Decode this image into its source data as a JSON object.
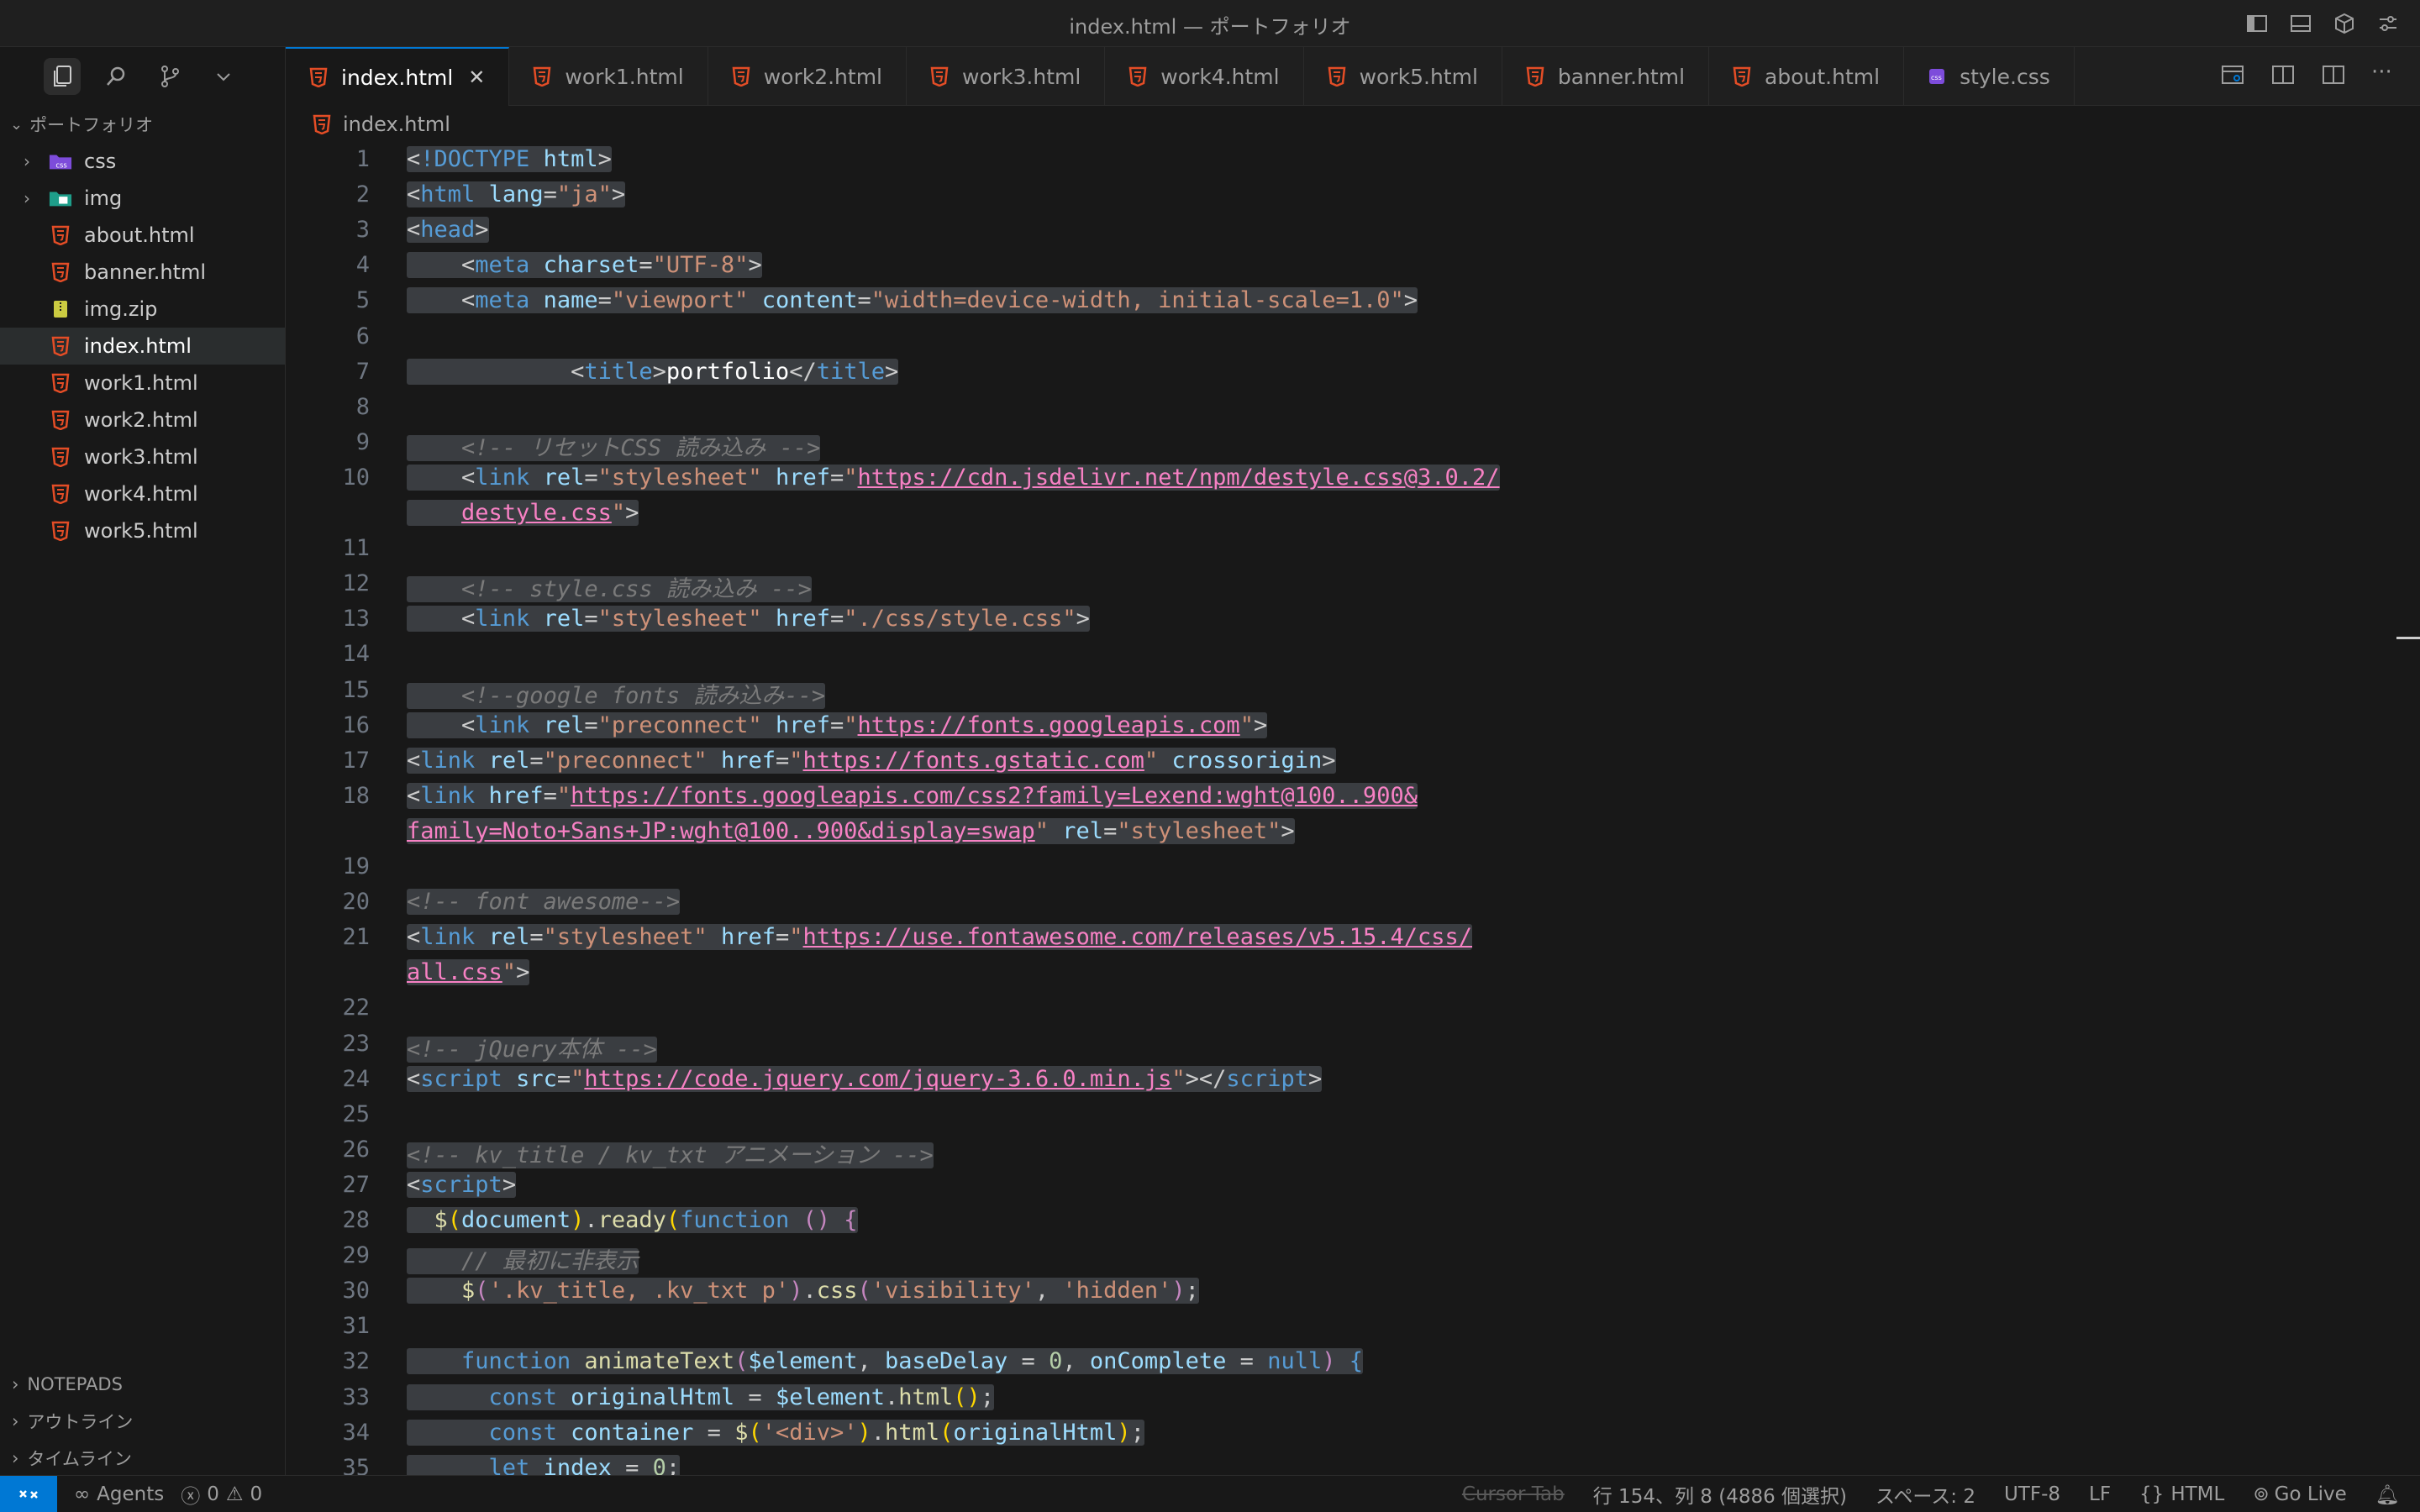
{
  "window": {
    "title": "index.html — ポートフォリオ"
  },
  "sidebar": {
    "project": "ポートフォリオ",
    "tree": [
      {
        "type": "folder",
        "label": "css",
        "icon": "css-folder-icon"
      },
      {
        "type": "folder",
        "label": "img",
        "icon": "image-folder-icon"
      },
      {
        "type": "file",
        "label": "about.html",
        "icon": "html-file-icon"
      },
      {
        "type": "file",
        "label": "banner.html",
        "icon": "html-file-icon"
      },
      {
        "type": "file",
        "label": "img.zip",
        "icon": "zip-file-icon"
      },
      {
        "type": "file",
        "label": "index.html",
        "icon": "html-file-icon",
        "selected": true
      },
      {
        "type": "file",
        "label": "work1.html",
        "icon": "html-file-icon"
      },
      {
        "type": "file",
        "label": "work2.html",
        "icon": "html-file-icon"
      },
      {
        "type": "file",
        "label": "work3.html",
        "icon": "html-file-icon"
      },
      {
        "type": "file",
        "label": "work4.html",
        "icon": "html-file-icon"
      },
      {
        "type": "file",
        "label": "work5.html",
        "icon": "html-file-icon"
      }
    ],
    "sections": [
      "NOTEPADS",
      "アウトライン",
      "タイムライン"
    ]
  },
  "tabs": [
    {
      "label": "index.html",
      "active": true
    },
    {
      "label": "work1.html"
    },
    {
      "label": "work2.html"
    },
    {
      "label": "work3.html"
    },
    {
      "label": "work4.html"
    },
    {
      "label": "work5.html"
    },
    {
      "label": "banner.html"
    },
    {
      "label": "about.html"
    },
    {
      "label": "style.css",
      "css": true
    }
  ],
  "breadcrumb": "index.html",
  "code": [
    {
      "n": "1",
      "h": "<span class='hl'>&lt;<span class='t'>!DOCTYPE</span> <span class='a'>html</span>&gt;</span>"
    },
    {
      "n": "2",
      "h": "<span class='hl'>&lt;<span class='t'>html</span> <span class='a'>lang</span>=<span class='s'>\"ja\"</span>&gt;</span>"
    },
    {
      "n": "3",
      "h": "<span class='hl'>&lt;<span class='t'>head</span>&gt;</span>"
    },
    {
      "n": "4",
      "h": "<span class='hl'>    &lt;<span class='t'>meta</span> <span class='a'>charset</span>=<span class='s'>\"UTF-8\"</span>&gt;</span>"
    },
    {
      "n": "5",
      "h": "<span class='hl'>    &lt;<span class='t'>meta</span> <span class='a'>name</span>=<span class='s'>\"viewport\"</span> <span class='a'>content</span>=<span class='s'>\"width=device-width, initial-scale=1.0\"</span>&gt;</span>"
    },
    {
      "n": "6",
      "h": ""
    },
    {
      "n": "7",
      "h": "<span class='hl'>            &lt;<span class='t'>title</span>&gt;<span class='w'>portfolio</span>&lt;/<span class='t'>title</span>&gt;</span>"
    },
    {
      "n": "8",
      "h": ""
    },
    {
      "n": "9",
      "h": "<span class='hl'>    <span class='c'>&lt;!-- リセットCSS 読み込み --&gt;</span></span>"
    },
    {
      "n": "10",
      "h": "<span class='hl'>    &lt;<span class='t'>link</span> <span class='a'>rel</span>=<span class='s'>\"stylesheet\"</span> <span class='a'>href</span>=<span class='s'>\"</span><span class='u'>https://cdn.jsdelivr.net/npm/destyle.css@3.0.2/</span></span>"
    },
    {
      "n": "",
      "h": "<span class='hl'>    <span class='u'>destyle.css</span><span class='s'>\"</span>&gt;</span>"
    },
    {
      "n": "11",
      "h": ""
    },
    {
      "n": "12",
      "h": "<span class='hl'>    <span class='c'>&lt;!-- style.css 読み込み --&gt;</span></span>"
    },
    {
      "n": "13",
      "h": "<span class='hl'>    &lt;<span class='t'>link</span> <span class='a'>rel</span>=<span class='s'>\"stylesheet\"</span> <span class='a'>href</span>=<span class='s'>\"./css/style.css\"</span>&gt;</span>"
    },
    {
      "n": "14",
      "h": ""
    },
    {
      "n": "15",
      "h": "<span class='hl'>    <span class='c'>&lt;!--google fonts 読み込み--&gt;</span></span>"
    },
    {
      "n": "16",
      "h": "<span class='hl'>    &lt;<span class='t'>link</span> <span class='a'>rel</span>=<span class='s'>\"preconnect\"</span> <span class='a'>href</span>=<span class='s'>\"</span><span class='u'>https://fonts.googleapis.com</span><span class='s'>\"</span>&gt;</span>"
    },
    {
      "n": "17",
      "h": "<span class='hl'>&lt;<span class='t'>link</span> <span class='a'>rel</span>=<span class='s'>\"preconnect\"</span> <span class='a'>href</span>=<span class='s'>\"</span><span class='u'>https://fonts.gstatic.com</span><span class='s'>\"</span> <span class='a'>crossorigin</span>&gt;</span>"
    },
    {
      "n": "18",
      "h": "<span class='hl'>&lt;<span class='t'>link</span> <span class='a'>href</span>=<span class='s'>\"</span><span class='u'>https://fonts.googleapis.com/css2?family=Lexend:wght@100..900&amp;</span></span>"
    },
    {
      "n": "",
      "h": "<span class='hl'><span class='u'>family=Noto+Sans+JP:wght@100..900&amp;display=swap</span><span class='s'>\"</span> <span class='a'>rel</span>=<span class='s'>\"stylesheet\"</span>&gt;</span>"
    },
    {
      "n": "19",
      "h": ""
    },
    {
      "n": "20",
      "h": "<span class='hl'><span class='c'>&lt;!-- font awesome--&gt;</span></span>"
    },
    {
      "n": "21",
      "h": "<span class='hl'>&lt;<span class='t'>link</span> <span class='a'>rel</span>=<span class='s'>\"stylesheet\"</span> <span class='a'>href</span>=<span class='s'>\"</span><span class='u'>https://use.fontawesome.com/releases/v5.15.4/css/</span></span>"
    },
    {
      "n": "",
      "h": "<span class='hl'><span class='u'>all.css</span><span class='s'>\"</span>&gt;</span>"
    },
    {
      "n": "22",
      "h": ""
    },
    {
      "n": "23",
      "h": "<span class='hl'><span class='c'>&lt;!-- jQuery本体 --&gt;</span></span>"
    },
    {
      "n": "24",
      "h": "<span class='hl'>&lt;<span class='t'>script</span> <span class='a'>src</span>=<span class='s'>\"</span><span class='u'>https://code.jquery.com/jquery-3.6.0.min.js</span><span class='s'>\"</span>&gt;&lt;/<span class='t'>script</span>&gt;</span>"
    },
    {
      "n": "25",
      "h": ""
    },
    {
      "n": "26",
      "h": "<span class='hl'><span class='c'>&lt;!-- kv_title / kv_txt アニメーション --&gt;</span></span>"
    },
    {
      "n": "27",
      "h": "<span class='hl'>&lt;<span class='t'>script</span>&gt;</span>"
    },
    {
      "n": "28",
      "h": "<span class='hl'>  <span class='f'>$</span><span class='p'>(</span><span class='a'>document</span><span class='p'>)</span>.<span class='f'>ready</span><span class='p'>(</span><span class='t'>function</span> <span class='k'>()</span> <span class='k'>{</span></span>"
    },
    {
      "n": "29",
      "h": "<span class='hl'>    <span class='c'>// 最初に非表示</span></span>"
    },
    {
      "n": "30",
      "h": "<span class='hl'>    <span class='f'>$</span><span class='k'>(</span><span class='s'>'.kv_title, .kv_txt p'</span><span class='k'>)</span>.<span class='f'>css</span><span class='k'>(</span><span class='s'>'visibility'</span>, <span class='s'>'hidden'</span><span class='k'>)</span>;</span>"
    },
    {
      "n": "31",
      "h": ""
    },
    {
      "n": "32",
      "h": "<span class='hl'>    <span class='t'>function</span> <span class='f'>animateText</span><span class='k'>(</span><span class='a'>$element</span>, <span class='a'>baseDelay</span> = <span class='n'>0</span>, <span class='a'>onComplete</span> = <span class='t'>null</span><span class='k'>)</span> <span class='t'>{</span></span>"
    },
    {
      "n": "33",
      "h": "<span class='hl'>      <span class='t'>const</span> <span class='a'>originalHtml</span> = <span class='a'>$element</span>.<span class='f'>html</span><span class='p'>()</span>;</span>"
    },
    {
      "n": "34",
      "h": "<span class='hl'>      <span class='t'>const</span> <span class='a'>container</span> = <span class='f'>$</span><span class='p'>(</span><span class='s'>'&lt;div&gt;'</span><span class='p'>)</span>.<span class='f'>html</span><span class='p'>(</span><span class='a'>originalHtml</span><span class='p'>)</span>;</span>"
    },
    {
      "n": "35",
      "h": "<span class='hl'>      <span class='t'>let</span> <span class='a'>index</span> = <span class='n'>0</span>;</span>"
    }
  ],
  "status": {
    "agents": "Agents",
    "errors": "0",
    "warnings": "0",
    "cursor_tab": "Cursor Tab",
    "position": "行 154、列 8 (4886 個選択)",
    "spaces": "スペース: 2",
    "encoding": "UTF-8",
    "eol": "LF",
    "language": "HTML",
    "golive": "Go Live"
  }
}
